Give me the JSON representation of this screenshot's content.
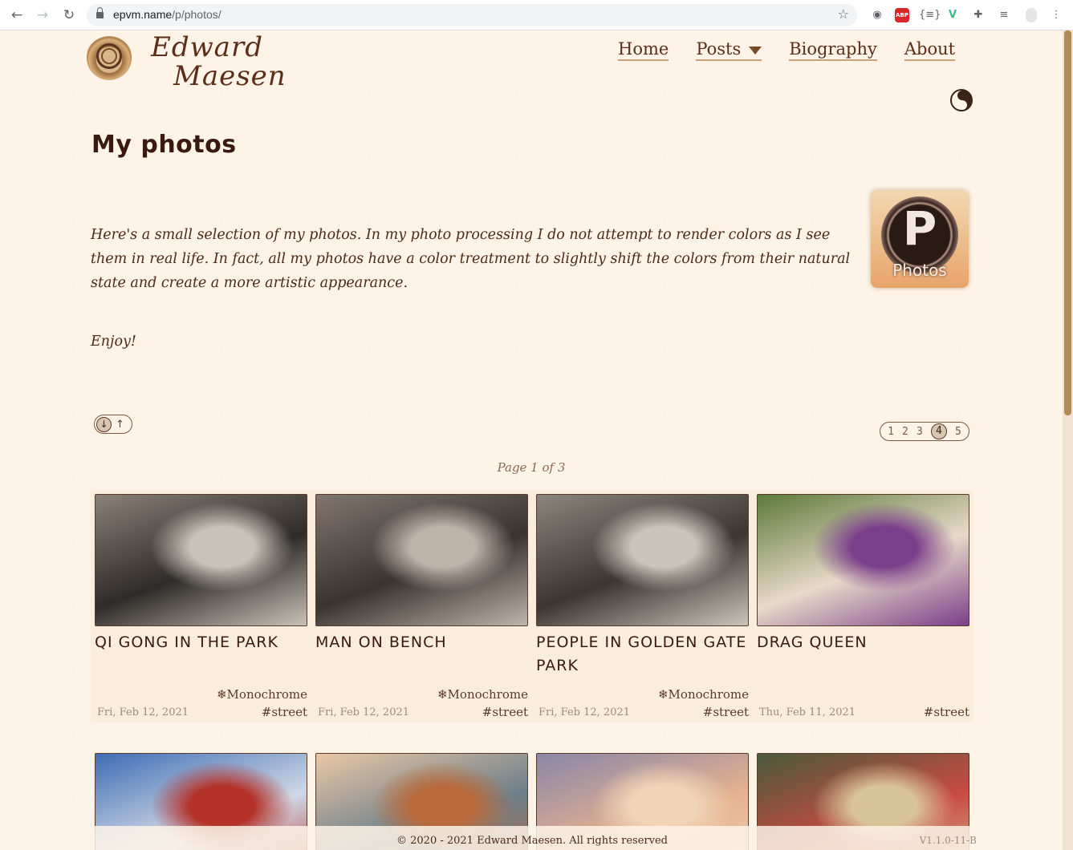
{
  "browser": {
    "url_host": "epvm.name",
    "url_path": "/p/photos/",
    "back_icon": "←",
    "forward_icon": "→",
    "reload_icon": "↻",
    "star_icon": "☆"
  },
  "site": {
    "signature_line1": "Edward",
    "signature_line2": "Maesen",
    "menu": [
      {
        "label": "Home"
      },
      {
        "label": "Posts"
      },
      {
        "label": "Biography"
      },
      {
        "label": "About"
      }
    ]
  },
  "page": {
    "title": "My photos",
    "badge_letter": "P",
    "badge_caption": "Photos",
    "intro": "Here's a small selection of my photos. In my photo processing I do not attempt to render colors as I see them in real life. In fact, all my photos have a color treatment to slightly shift the colors from their natural state and create a more artistic appearance.",
    "enjoy": "Enjoy!",
    "sort_down_icon": "↓",
    "sort_up_icon": "↑",
    "pager": [
      "1",
      "2",
      "3",
      "4",
      "5"
    ],
    "pager_current": "4",
    "page_info": "Page 1 of 3"
  },
  "photos": [
    {
      "title": "Qi Gong in the Park",
      "tag1": "❄Monochrome",
      "tag2": "#street",
      "date": "Fri, Feb 12, 2021",
      "colors": [
        "#8a8178",
        "#2f2b28",
        "#c9c2b8"
      ]
    },
    {
      "title": "Man on Bench",
      "tag1": "❄Monochrome",
      "tag2": "#street",
      "date": "Fri, Feb 12, 2021",
      "colors": [
        "#7f776f",
        "#3a342f",
        "#bdb4aa"
      ]
    },
    {
      "title": "People in Golden Gate Park",
      "tag1": "❄Monochrome",
      "tag2": "#street",
      "date": "Fri, Feb 12, 2021",
      "colors": [
        "#8c857d",
        "#3b3631",
        "#cbc4bb"
      ]
    },
    {
      "title": "Drag Queen",
      "tag1": "",
      "tag2": "#street",
      "date": "Thu, Feb 11, 2021",
      "colors": [
        "#5c7a3a",
        "#e8d9c8",
        "#7a3f8a"
      ]
    },
    {
      "title": "",
      "tag1": "",
      "tag2": "",
      "date": "",
      "colors": [
        "#3f6db4",
        "#cfd8e6",
        "#b4322a"
      ]
    },
    {
      "title": "",
      "tag1": "",
      "tag2": "",
      "date": "",
      "colors": [
        "#e9c7a6",
        "#6d7f8a",
        "#b86a3c"
      ]
    },
    {
      "title": "",
      "tag1": "",
      "tag2": "",
      "date": "",
      "colors": [
        "#8a86a8",
        "#e5b28f",
        "#f0d4b8"
      ]
    },
    {
      "title": "",
      "tag1": "",
      "tag2": "",
      "date": "",
      "colors": [
        "#4a5a3a",
        "#c94a44",
        "#d9c49a"
      ]
    }
  ],
  "footer": {
    "copyright": "© 2020 - 2021 Edward Maesen. All rights reserved",
    "version": "V1.1.0-11-B"
  }
}
